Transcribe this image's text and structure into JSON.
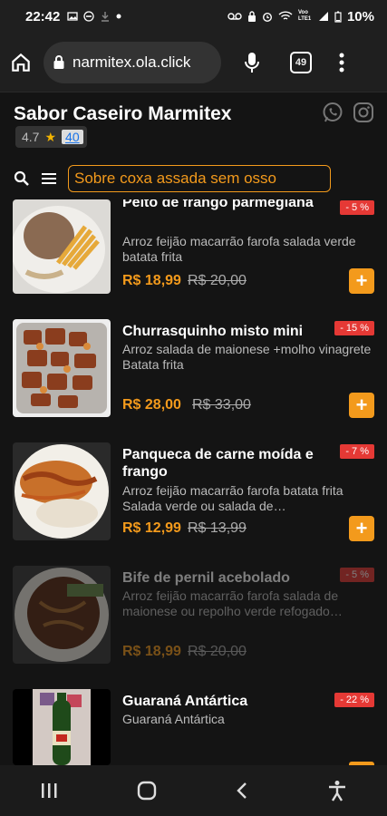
{
  "status": {
    "time": "22:42",
    "battery": "10%",
    "icons": [
      "photo-icon",
      "dnd-icon",
      "download-icon",
      "dot-icon",
      "voicemail-icon",
      "lock-icon",
      "alarm-icon",
      "wifi-icon",
      "signal-icon",
      "battery-icon"
    ],
    "net_label": "Voo LTE1"
  },
  "browser": {
    "url": "narmitex.ola.click",
    "tab_count": "49"
  },
  "store": {
    "title": "Sabor Caseiro Marmitex",
    "rating": "4.7",
    "reviews": "40"
  },
  "search": {
    "text": "Sobre coxa assada sem osso"
  },
  "colors": {
    "accent": "#f39a1c",
    "badge": "#e53935"
  },
  "items": [
    {
      "name": "Peito de frango parmegiana",
      "desc": "Arroz feijão macarrão farofa salada verde batata frita",
      "price": "R$ 18,99",
      "old": "R$ 20,00",
      "discount": "- 5 %"
    },
    {
      "name": "Churrasquinho misto mini",
      "desc": "Arroz salada de maionese +molho vinagrete Batata frita",
      "price": "R$ 28,00",
      "old": "R$ 33,00",
      "discount": "- 15 %"
    },
    {
      "name": "Panqueca de carne moída e frango",
      "desc": "Arroz feijão macarrão farofa batata frita Salada verde ou salada de…",
      "price": "R$ 12,99",
      "old": "R$ 13,99",
      "discount": "- 7 %"
    },
    {
      "name": "Bife de pernil acebolado",
      "desc": "Arroz feijão macarrão farofa salada de maionese ou repolho verde refogado…",
      "price": "R$ 18,99",
      "old": "R$ 20,00",
      "discount": "- 5 %"
    },
    {
      "name": "Guaraná Antártica",
      "desc": "Guaraná Antártica",
      "discount": "- 22 %"
    }
  ]
}
